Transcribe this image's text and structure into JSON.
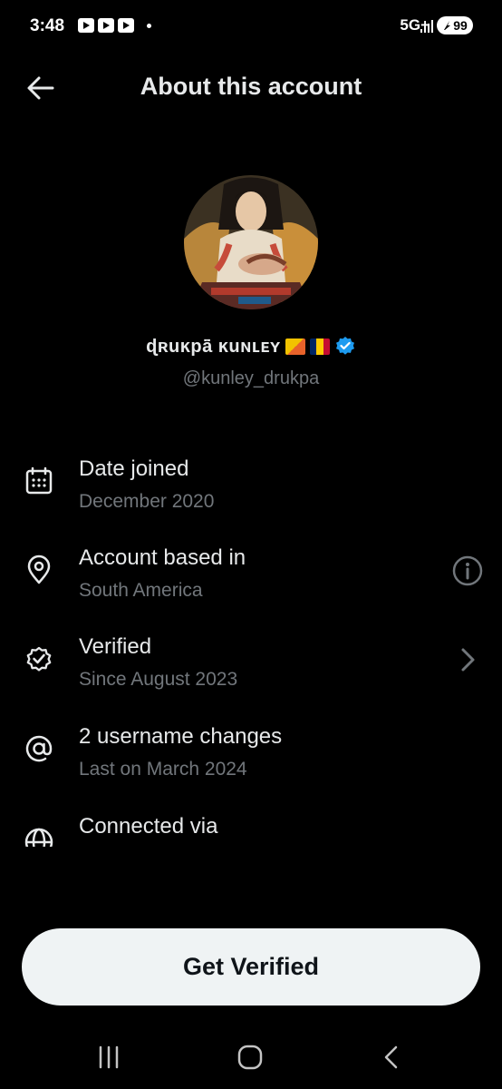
{
  "status_bar": {
    "time": "3:48",
    "network": "5G+",
    "battery": "99",
    "colors": {
      "text": "#ffffff"
    }
  },
  "header": {
    "back_icon": "arrow-left-icon",
    "title": "About this account"
  },
  "profile": {
    "display_name": "ɖʀuĸpā̈ ĸuɴʟᴇʏ",
    "flags": [
      "flag-bhutan",
      "flag-chad"
    ],
    "verified_badge": "verified-badge-icon",
    "handle": "@kunley_drukpa"
  },
  "details": [
    {
      "icon": "calendar-icon",
      "title": "Date joined",
      "subtitle": "December 2020",
      "trailing": ""
    },
    {
      "icon": "location-pin-icon",
      "title": "Account based in",
      "subtitle": "South America",
      "trailing": "info-icon"
    },
    {
      "icon": "verified-check-icon",
      "title": "Verified",
      "subtitle": "Since August 2023",
      "trailing": "chevron-right-icon"
    },
    {
      "icon": "at-sign-icon",
      "title": "2 username changes",
      "subtitle": "Last on March 2024",
      "trailing": ""
    },
    {
      "icon": "globe-icon",
      "title": "Connected via",
      "subtitle": "",
      "trailing": ""
    }
  ],
  "cta": {
    "label": "Get Verified"
  },
  "system_nav": {
    "recents": "recents-icon",
    "home": "home-icon",
    "back": "back-icon"
  },
  "colors": {
    "background": "#000000",
    "primary_text": "#e7e9ea",
    "secondary_text": "#71767b",
    "verified_blue": "#1d9bf0",
    "button_bg": "#eff3f4"
  }
}
